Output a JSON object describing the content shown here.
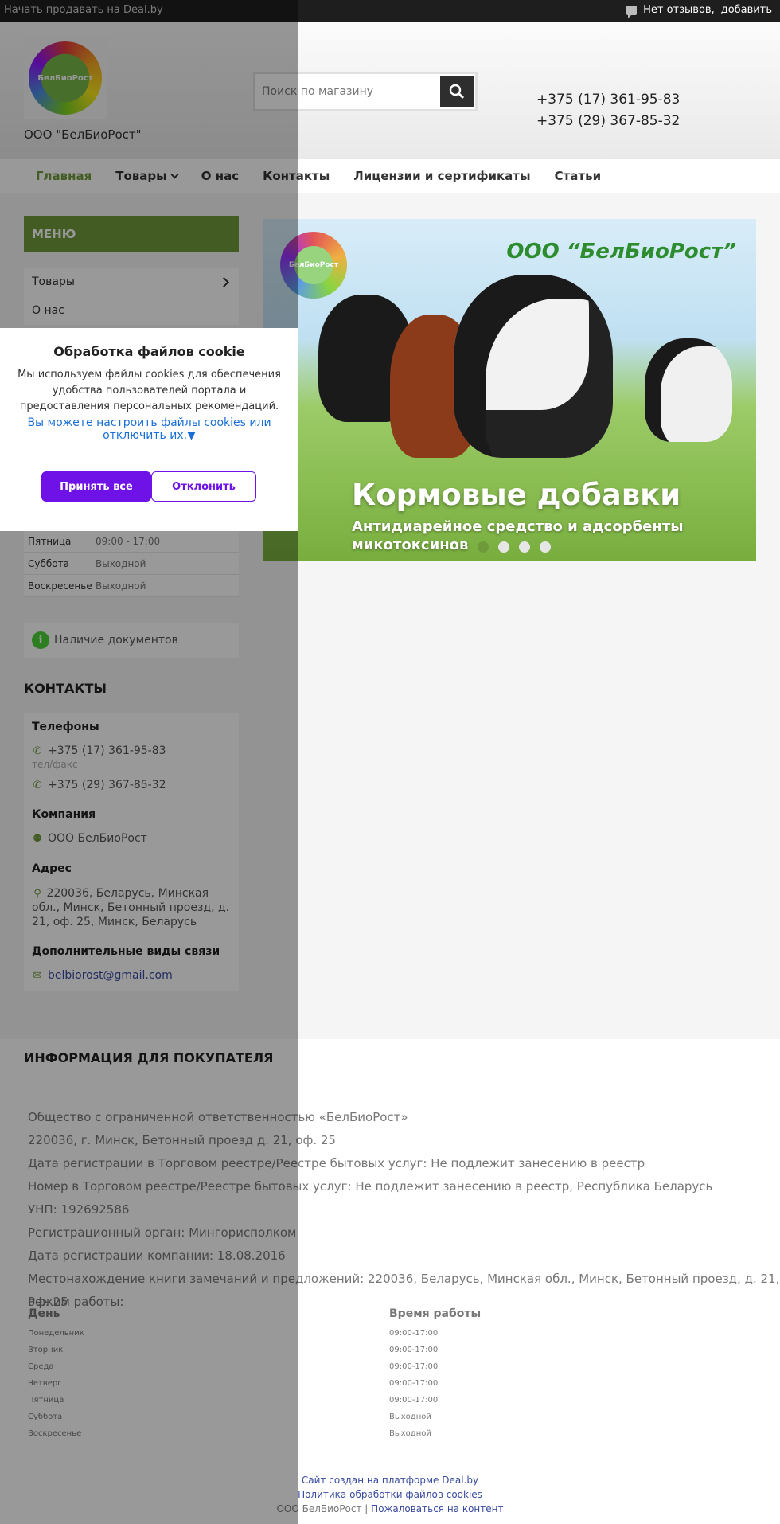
{
  "topbar": {
    "sell_link": "Начать продавать на Deal.by",
    "reviews_text": "Нет отзывов,",
    "reviews_add": "добавить"
  },
  "header": {
    "logo_text": "БелБиоРост",
    "company": "ООО \"БелБиоРост\"",
    "search_placeholder": "Поиск по магазину",
    "phones": [
      "+375 (17) 361-95-83",
      "+375 (29) 367-85-32"
    ]
  },
  "nav": {
    "items": [
      "Главная",
      "Товары",
      "О нас",
      "Контакты",
      "Лицензии и сертификаты",
      "Статьи"
    ]
  },
  "sidebar": {
    "menu_title": "МЕНЮ",
    "menu_items": [
      "Товары",
      "О нас"
    ],
    "hours": [
      {
        "day": "Пятница",
        "time": "09:00 - 17:00"
      },
      {
        "day": "Суббота",
        "time": "Выходной"
      },
      {
        "day": "Воскресенье",
        "time": "Выходной"
      }
    ],
    "docs": "Наличие документов",
    "contacts_title": "КОНТАКТЫ",
    "phones_title": "Телефоны",
    "phone1": "+375 (17) 361-95-83",
    "phone1_note": "тел/факс",
    "phone2": "+375 (29) 367-85-32",
    "company_title": "Компания",
    "company_name": "ООО БелБиоРост",
    "address_title": "Адрес",
    "address": "220036, Беларусь, Минская обл., Минск, Бетонный проезд, д. 21, оф. 25, Минск, Беларусь",
    "extra_title": "Дополнительные виды связи",
    "email": "belbiorost@gmail.com"
  },
  "banner": {
    "logo_text": "БелБиоРост",
    "brand": "ООО “БелБиоРост”",
    "title": "Кормовые добавки",
    "subtitle_1": "Антидиарейное средство и адсорбенты",
    "subtitle_2": "микотоксинов",
    "slide_count": 4,
    "active_slide": 1
  },
  "info": {
    "title": "ИНФОРМАЦИЯ ДЛЯ ПОКУПАТЕЛЯ",
    "lines": [
      "Общество с ограниченной ответственностью «БелБиоРост»",
      "220036, г. Минск, Бетонный проезд д. 21, оф. 25",
      "Дата регистрации в Торговом реестре/Реестре бытовых услуг: Не подлежит занесению в реестр",
      "Номер в Торговом реестре/Реестре бытовых услуг: Не подлежит занесению в реестр, Республика Беларусь",
      "УНП: 192692586",
      "Регистрационный орган: Мингорисполком",
      "Дата регистрации компании: 18.08.2016",
      "Местонахождение книги замечаний и предложений: 220036, Беларусь, Минская обл., Минск, Бетонный проезд, д. 21, оф. 25",
      "Режим работы:"
    ],
    "schedule_head_day": "День",
    "schedule_head_time": "Время работы",
    "schedule": [
      {
        "day": "Понедельник",
        "time": "09:00-17:00"
      },
      {
        "day": "Вторник",
        "time": "09:00-17:00"
      },
      {
        "day": "Среда",
        "time": "09:00-17:00"
      },
      {
        "day": "Четверг",
        "time": "09:00-17:00"
      },
      {
        "day": "Пятница",
        "time": "09:00-17:00"
      },
      {
        "day": "Суббота",
        "time": "Выходной"
      },
      {
        "day": "Воскресенье",
        "time": "Выходной"
      }
    ]
  },
  "footer": {
    "platform_link": "Сайт создан на платформе Deal.by",
    "cookie_policy": "Политика обработки файлов cookies",
    "company": "ООО БелБиоРост",
    "separator": "|",
    "complain": "Пожаловаться на контент"
  },
  "cookie": {
    "title": "Обработка файлов cookie",
    "text": "Мы используем файлы cookies для обеспечения удобства пользователей портала и предоставления персональных рекомендаций.",
    "settings_link": "Вы можете настроить файлы cookies или отключить их.▼",
    "accept": "Принять все",
    "decline": "Отклонить"
  },
  "colors": {
    "accent_green": "#6e9a3c",
    "cookie_purple": "#6f12e8",
    "link_blue": "#3a4ba0"
  }
}
